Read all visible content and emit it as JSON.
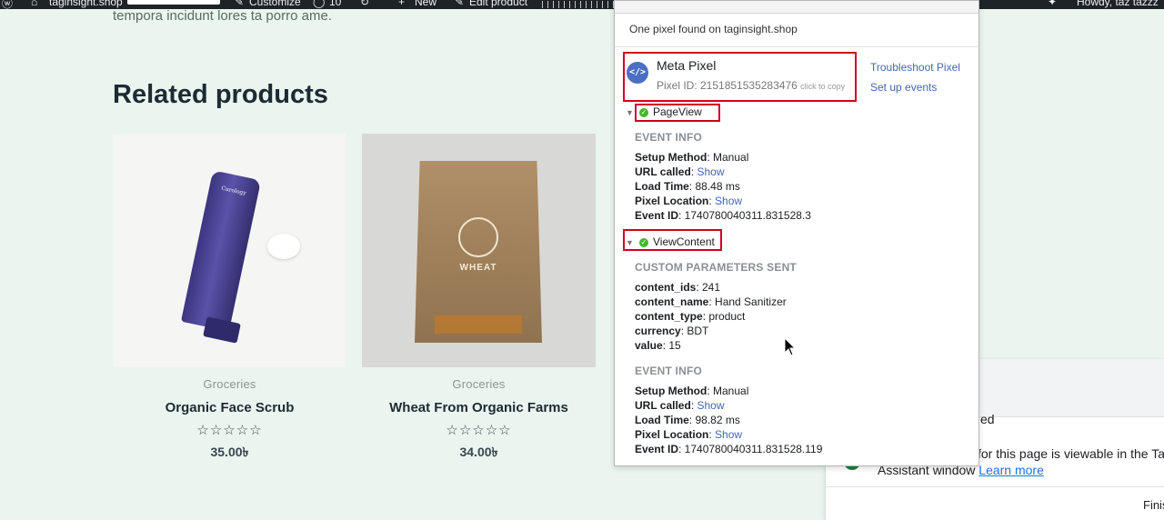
{
  "admin_bar": {
    "site_name": "taginsight.shop",
    "customize": "Customize",
    "comments_count": "10",
    "new_label": "New",
    "edit_label": "Edit product",
    "greeting": "Howdy, taz tazzz"
  },
  "page": {
    "intro_text": "tempora incidunt lores ta porro ame.",
    "related_heading": "Related products",
    "products": [
      {
        "category": "Groceries",
        "name": "Organic Face Scrub",
        "rating_stars": "☆☆☆☆☆",
        "price": "35.00৳",
        "image_label": "Curology"
      },
      {
        "category": "Groceries",
        "name": "Wheat From Organic Farms",
        "rating_stars": "☆☆☆☆☆",
        "price": "34.00৳",
        "image_label": "WHEAT"
      }
    ]
  },
  "pixel_helper": {
    "found_text": "One pixel found on taginsight.shop",
    "pixel": {
      "icon": "</>",
      "name": "Meta Pixel",
      "id_text": "Pixel ID: 2151851535283476",
      "copy_hint": "click to copy"
    },
    "links": {
      "troubleshoot": "Troubleshoot Pixel",
      "setup_events": "Set up events"
    },
    "events": [
      {
        "name": "PageView",
        "event_info_heading": "EVENT INFO",
        "setup_method_label": "Setup Method",
        "setup_method_value": ": Manual",
        "url_called_label": "URL called",
        "show_label": "Show",
        "load_time_label": "Load Time",
        "load_time_value": ": 88.48 ms",
        "pixel_location_label": "Pixel Location",
        "event_id_label": "Event ID",
        "event_id_value": ": 1740780040311.831528.3"
      },
      {
        "name": "ViewContent",
        "custom_params_heading": "CUSTOM PARAMETERS SENT",
        "params": [
          {
            "key": "content_ids",
            "value": ": 241"
          },
          {
            "key": "content_name",
            "value": ": Hand Sanitizer"
          },
          {
            "key": "content_type",
            "value": ": product"
          },
          {
            "key": "currency",
            "value": ": BDT"
          },
          {
            "key": "value",
            "value": ": 15"
          }
        ],
        "event_info_heading": "EVENT INFO",
        "setup_method_label": "Setup Method",
        "setup_method_value": ": Manual",
        "url_called_label": "URL called",
        "show_label": "Show",
        "load_time_label": "Load Time",
        "load_time_value": ": 98.82 ms",
        "pixel_location_label": "Pixel Location",
        "event_id_label": "Event ID",
        "event_id_value": ": 1740780040311.831528.119"
      }
    ]
  },
  "tag_assistant": {
    "line1": "ed",
    "line2": "for this page is viewable in the Tag",
    "line3_prefix": "Assistant window ",
    "learn_more": "Learn more",
    "finish": "Finis"
  },
  "colors": {
    "page_bg": "#eaf5ef",
    "highlight_red": "#d0021b",
    "link_blue": "#4267b2",
    "success_green": "#42b72a"
  }
}
